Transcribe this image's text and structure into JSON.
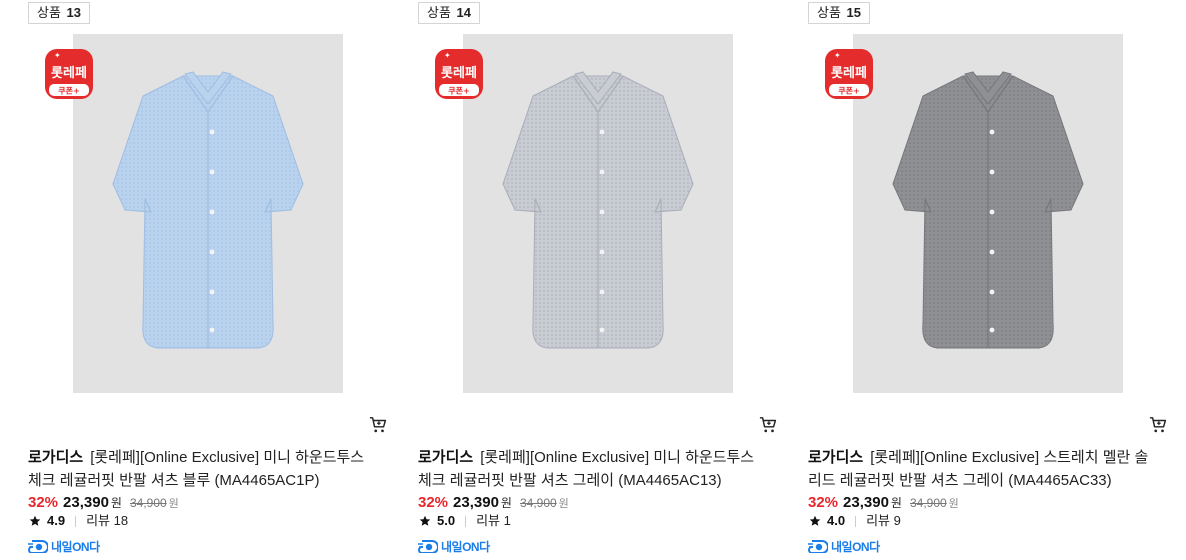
{
  "products": [
    {
      "rank_label": "상품",
      "rank_num": "13",
      "badge_main": "롯레페",
      "badge_sub": "쿠폰+",
      "brand": "로가디스",
      "name": "[롯레페][Online Exclusive] 미니 하운드투스 체크 레귤러핏 반팔 셔츠 블루 (MA4465AC1P)",
      "discount": "32%",
      "price": "23,390",
      "price_unit": "원",
      "original_price": "34,900",
      "original_unit": "원",
      "rating": "4.9",
      "review_label": "리뷰",
      "review_count": "18",
      "delivery": "내일ON다",
      "shirt_color": "#b9d3ef",
      "shirt_shade": "#9fbde2"
    },
    {
      "rank_label": "상품",
      "rank_num": "14",
      "badge_main": "롯레페",
      "badge_sub": "쿠폰+",
      "brand": "로가디스",
      "name": "[롯레페][Online Exclusive] 미니 하운드투스 체크 레귤러핏 반팔 셔츠 그레이 (MA4465AC13)",
      "discount": "32%",
      "price": "23,390",
      "price_unit": "원",
      "original_price": "34,900",
      "original_unit": "원",
      "rating": "5.0",
      "review_label": "리뷰",
      "review_count": "1",
      "delivery": "내일ON다",
      "shirt_color": "#c9ccd3",
      "shirt_shade": "#a9adb8"
    },
    {
      "rank_label": "상품",
      "rank_num": "15",
      "badge_main": "롯레페",
      "badge_sub": "쿠폰+",
      "brand": "로가디스",
      "name": "[롯레페][Online Exclusive] 스트레치 멜란 솔리드 레귤러핏 반팔 셔츠 그레이 (MA4465AC33)",
      "discount": "32%",
      "price": "23,390",
      "price_unit": "원",
      "original_price": "34,900",
      "original_unit": "원",
      "rating": "4.0",
      "review_label": "리뷰",
      "review_count": "9",
      "delivery": "내일ON다",
      "shirt_color": "#8f9093",
      "shirt_shade": "#76777a"
    }
  ],
  "colors": {
    "accent_red": "#e8262b",
    "delivery_blue": "#1b7ee8",
    "image_bg": "#e2e2e2"
  }
}
